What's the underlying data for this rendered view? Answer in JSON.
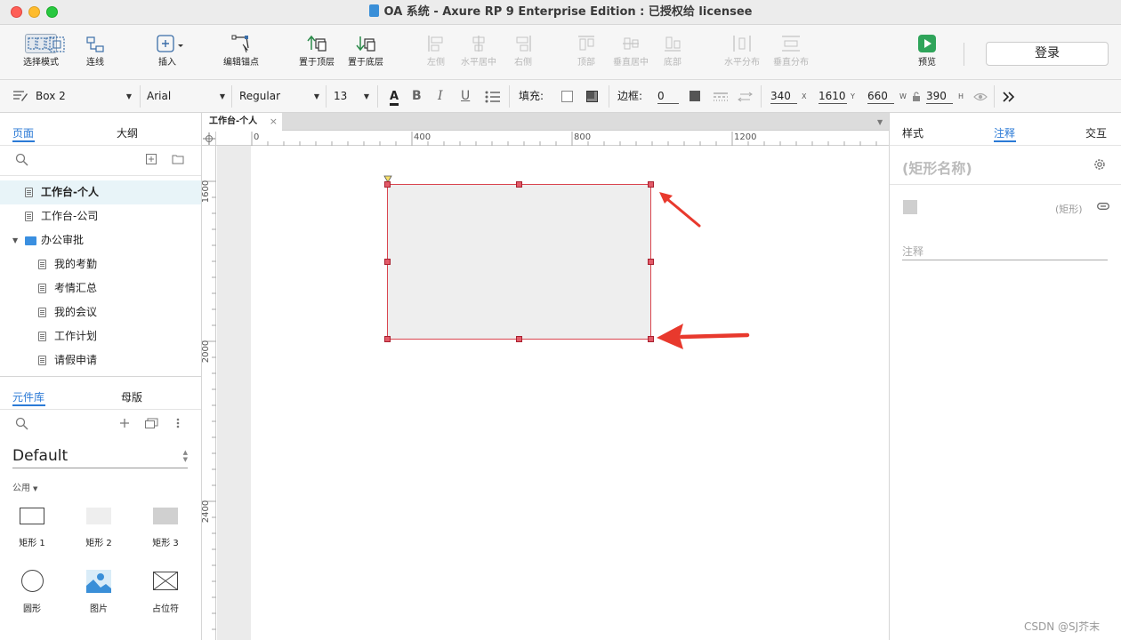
{
  "window": {
    "title": "OA 系统 - Axure RP 9 Enterprise Edition : 已授权给 licensee"
  },
  "toolbar": {
    "select_mode": "选择模式",
    "connect": "连线",
    "insert": "插入",
    "edit_points": "编辑锚点",
    "bring_to_front": "置于顶层",
    "send_to_back": "置于底层",
    "align_left": "左侧",
    "align_center": "水平居中",
    "align_right": "右侧",
    "align_top": "顶部",
    "align_middle": "垂直居中",
    "align_bottom": "底部",
    "distribute_h": "水平分布",
    "distribute_v": "垂直分布",
    "preview": "预览",
    "login": "登录"
  },
  "format": {
    "widget_name": "Box 2",
    "font_family": "Arial",
    "font_style": "Regular",
    "font_size": "13",
    "fill_label": "填充:",
    "border_label": "边框:",
    "border_width": "0",
    "x": "340",
    "y": "1610",
    "w": "660",
    "h": "390",
    "x_label": "X",
    "y_label": "Y",
    "w_label": "W",
    "h_label": "H"
  },
  "left_panel": {
    "tabs": [
      "页面",
      "大纲"
    ],
    "pages": [
      {
        "label": "工作台-个人"
      },
      {
        "label": "工作台-公司"
      },
      {
        "label": "办公审批"
      },
      {
        "label": "我的考勤"
      },
      {
        "label": "考情汇总"
      },
      {
        "label": "我的会议"
      },
      {
        "label": "工作计划"
      },
      {
        "label": "请假申请"
      }
    ],
    "library_tabs": [
      "元件库",
      "母版"
    ],
    "library_name": "Default",
    "category": "公用",
    "widgets": [
      {
        "label": "矩形 1"
      },
      {
        "label": "矩形 2"
      },
      {
        "label": "矩形 3"
      },
      {
        "label": "圆形"
      },
      {
        "label": "图片"
      },
      {
        "label": "占位符"
      }
    ]
  },
  "canvas": {
    "doc_tab": "工作台-个人",
    "h_ruler": [
      "0",
      "400",
      "800",
      "1200"
    ],
    "v_ruler": [
      "1600",
      "2000",
      "2400"
    ]
  },
  "right_panel": {
    "tabs": [
      "样式",
      "注释",
      "交互"
    ],
    "shape_name_placeholder": "(矩形名称)",
    "shape_type": "(矩形)",
    "note_label": "注释"
  },
  "watermark": "CSDN @SJ芥末",
  "colors": {
    "accent": "#2b7ad6",
    "selection": "#d9454f",
    "arrow": "#e8392d",
    "preview": "#2fa45a"
  }
}
